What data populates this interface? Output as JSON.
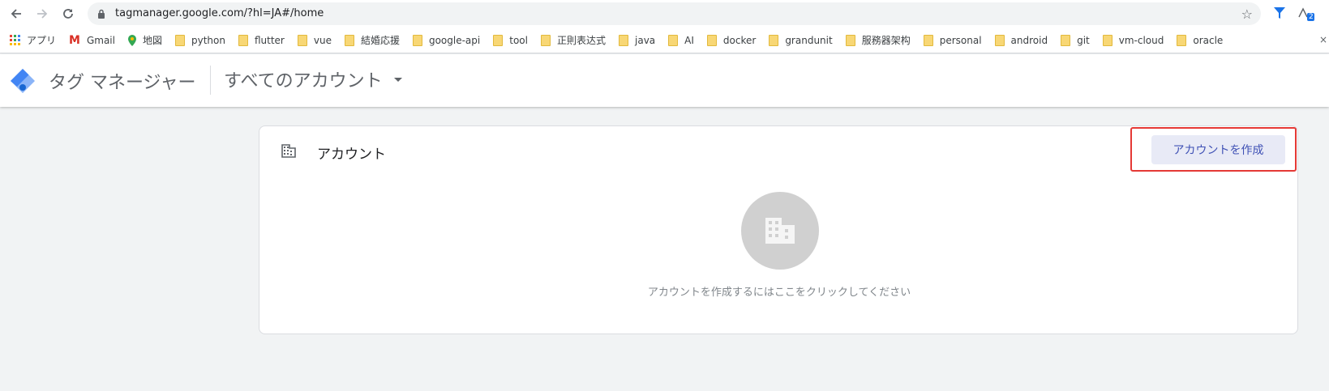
{
  "browser": {
    "url": "tagmanager.google.com/?hl=JA#/home",
    "bookmarks": [
      {
        "label": "アプリ",
        "icon": "apps-grid-icon"
      },
      {
        "label": "Gmail",
        "icon": "gmail-icon"
      },
      {
        "label": "地図",
        "icon": "maps-pin-icon"
      },
      {
        "label": "python",
        "icon": "folder-icon"
      },
      {
        "label": "flutter",
        "icon": "folder-icon"
      },
      {
        "label": "vue",
        "icon": "folder-icon"
      },
      {
        "label": "結婚応援",
        "icon": "folder-icon"
      },
      {
        "label": "google-api",
        "icon": "folder-icon"
      },
      {
        "label": "tool",
        "icon": "folder-icon"
      },
      {
        "label": "正則表达式",
        "icon": "folder-icon"
      },
      {
        "label": "java",
        "icon": "folder-icon"
      },
      {
        "label": "AI",
        "icon": "folder-icon"
      },
      {
        "label": "docker",
        "icon": "folder-icon"
      },
      {
        "label": "grandunit",
        "icon": "folder-icon"
      },
      {
        "label": "服務器架构",
        "icon": "folder-icon"
      },
      {
        "label": "personal",
        "icon": "folder-icon"
      },
      {
        "label": "android",
        "icon": "folder-icon"
      },
      {
        "label": "git",
        "icon": "folder-icon"
      },
      {
        "label": "vm-cloud",
        "icon": "folder-icon"
      },
      {
        "label": "oracle",
        "icon": "folder-icon"
      }
    ],
    "ext_badge": "2"
  },
  "header": {
    "app_name": "タグ マネージャー",
    "account_selector": "すべてのアカウント"
  },
  "card": {
    "title": "アカウント",
    "create_button": "アカウントを作成",
    "empty_message": "アカウントを作成するにはここをクリックしてください"
  },
  "colors": {
    "accent": "#3f51b5",
    "button_bg": "#e8eaf6",
    "highlight": "#e53935",
    "background": "#f1f3f4"
  }
}
